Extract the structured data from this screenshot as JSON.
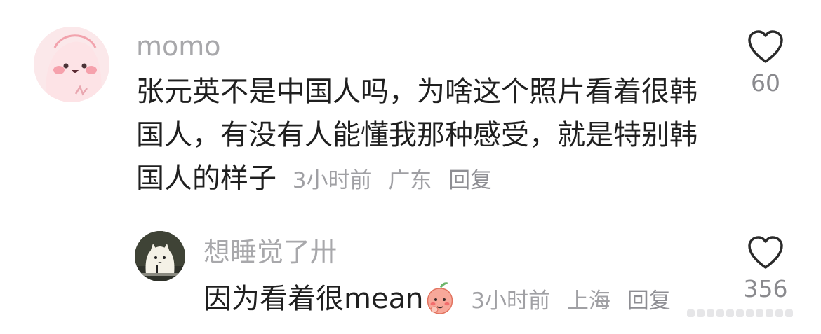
{
  "comments": [
    {
      "username": "momo",
      "text": "张元英不是中国人吗，为啥这个照片看着很韩国人，有没有人能懂我那种感受，就是特别韩国人的样子",
      "time": "3小时前",
      "location": "广东",
      "reply_label": "回复",
      "like_count": "60",
      "avatar_icon": "pink-blob-face-icon",
      "like_icon": "heart-outline-icon"
    },
    {
      "username": "想睡觉了卅",
      "text": "因为看着很mean",
      "emoji_icon": "peach-shy-emoji-icon",
      "time": "3小时前",
      "location": "上海",
      "reply_label": "回复",
      "like_count": "356",
      "avatar_icon": "cartoon-cat-at-desk-icon",
      "like_icon": "heart-outline-icon"
    }
  ],
  "colors": {
    "username": "#a8a8ab",
    "body_text": "#1f1f1f",
    "meta": "#a0a0a4",
    "avatar_pink_bg": "#fbe8ea",
    "avatar_cat_bg": "#3f4336"
  }
}
